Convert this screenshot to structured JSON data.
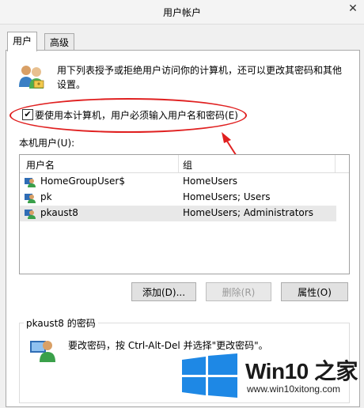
{
  "window": {
    "title": "用户帐户",
    "close_glyph": "✕"
  },
  "tabs": [
    {
      "label": "用户",
      "active": true
    },
    {
      "label": "高级",
      "active": false
    }
  ],
  "description": "用下列表授予或拒绝用户访问你的计算机，还可以更改其密码和其他设置。",
  "require_login": {
    "checked": true,
    "label": "要使用本计算机，用户必须输入用户名和密码(E)"
  },
  "users_section_label": "本机用户(U):",
  "users_table": {
    "columns": [
      "用户名",
      "组"
    ],
    "rows": [
      {
        "name": "HomeGroupUser$",
        "group": "HomeUsers",
        "selected": false
      },
      {
        "name": "pk",
        "group": "HomeUsers; Users",
        "selected": false
      },
      {
        "name": "pkaust8",
        "group": "HomeUsers; Administrators",
        "selected": true
      }
    ]
  },
  "buttons": {
    "add": "添加(D)...",
    "remove": "删除(R)",
    "properties": "属性(O)"
  },
  "password_group": {
    "label": "pkaust8 的密码",
    "text": "要改密码，按 Ctrl-Alt-Del 并选择\"更改密码\"。"
  },
  "watermark": {
    "brand": "Win10 之家",
    "url": "www.win10xitong.com"
  },
  "colors": {
    "annotation_red": "#e02020",
    "win_blue": "#1e88e5"
  }
}
